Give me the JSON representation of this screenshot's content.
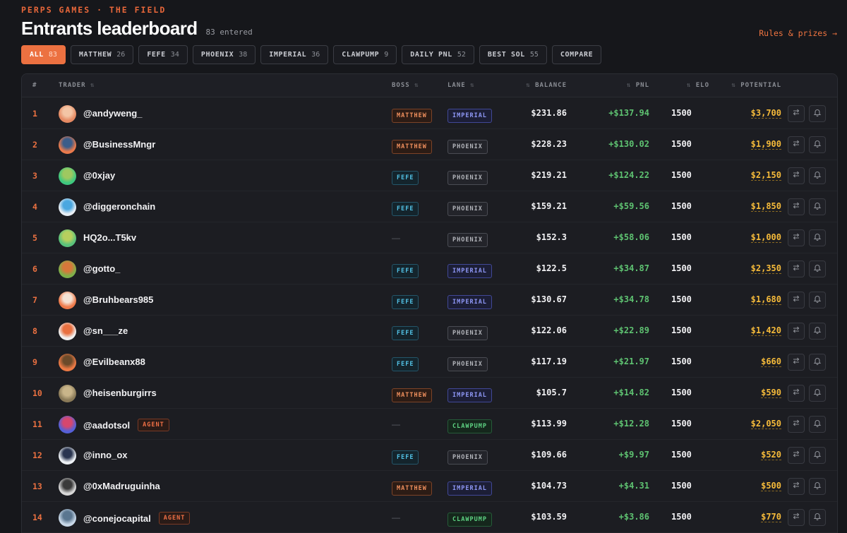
{
  "header": {
    "kicker": "PERPS GAMES · THE FIELD",
    "title": "Entrants leaderboard",
    "entered": "83 entered",
    "rules_link": "Rules & prizes →"
  },
  "tabs": [
    {
      "label": "ALL",
      "count": "83",
      "active": true
    },
    {
      "label": "MATTHEW",
      "count": "26"
    },
    {
      "label": "FEFE",
      "count": "34"
    },
    {
      "label": "PHOENIX",
      "count": "38"
    },
    {
      "label": "IMPERIAL",
      "count": "36"
    },
    {
      "label": "CLAWPUMP",
      "count": "9"
    },
    {
      "label": "DAILY PNL",
      "count": "52"
    },
    {
      "label": "BEST SOL",
      "count": "55"
    },
    {
      "label": "COMPARE",
      "count": ""
    }
  ],
  "columns": {
    "rank": "#",
    "trader": "TRADER",
    "boss": "BOSS",
    "lane": "LANE",
    "balance": "BALANCE",
    "pnl": "PNL",
    "elo": "ELO",
    "potential": "POTENTIAL",
    "sort_glyph": "⇅"
  },
  "colors": {
    "accent": "#ec7141",
    "positive": "#5ec271",
    "potential": "#f6bb3a"
  },
  "rows": [
    {
      "rank": "1",
      "handle": "@andyweng_",
      "boss": "MATTHEW",
      "lane": "IMPERIAL",
      "balance": "$231.86",
      "pnl": "+$137.94",
      "elo": "1500",
      "potential": "$3,700",
      "avatar": [
        "#e58a63",
        "#f3c5a5"
      ]
    },
    {
      "rank": "2",
      "handle": "@BusinessMngr",
      "boss": "MATTHEW",
      "lane": "PHOENIX",
      "balance": "$228.23",
      "pnl": "+$130.02",
      "elo": "1500",
      "potential": "$1,900",
      "avatar": [
        "#ea7a4c",
        "#3b5d8a"
      ]
    },
    {
      "rank": "3",
      "handle": "@0xjay",
      "boss": "FEFE",
      "lane": "PHOENIX",
      "balance": "$219.21",
      "pnl": "+$124.22",
      "elo": "1500",
      "potential": "$2,150",
      "avatar": [
        "#3ec87f",
        "#9ec860"
      ]
    },
    {
      "rank": "4",
      "handle": "@diggeronchain",
      "boss": "FEFE",
      "lane": "PHOENIX",
      "balance": "$159.21",
      "pnl": "+$59.56",
      "elo": "1500",
      "potential": "$1,850",
      "avatar": [
        "#e8eef4",
        "#4aa7e0"
      ]
    },
    {
      "rank": "5",
      "handle": "HQ2o...T5kv",
      "boss": "",
      "lane": "PHOENIX",
      "balance": "$152.3",
      "pnl": "+$58.06",
      "elo": "1500",
      "potential": "$1,000",
      "avatar": [
        "#59c27b",
        "#b7cf5e"
      ]
    },
    {
      "rank": "6",
      "handle": "@gotto_",
      "boss": "FEFE",
      "lane": "IMPERIAL",
      "balance": "$122.5",
      "pnl": "+$34.87",
      "elo": "1500",
      "potential": "$2,350",
      "avatar": [
        "#7fb04a",
        "#d8773a"
      ]
    },
    {
      "rank": "7",
      "handle": "@Bruhbears985",
      "boss": "FEFE",
      "lane": "IMPERIAL",
      "balance": "$130.67",
      "pnl": "+$34.78",
      "elo": "1500",
      "potential": "$1,680",
      "avatar": [
        "#ee7a4a",
        "#f4e2d4"
      ]
    },
    {
      "rank": "8",
      "handle": "@sn___ze",
      "boss": "FEFE",
      "lane": "PHOENIX",
      "balance": "$122.06",
      "pnl": "+$22.89",
      "elo": "1500",
      "potential": "$1,420",
      "avatar": [
        "#f0f0f0",
        "#e97040"
      ]
    },
    {
      "rank": "9",
      "handle": "@Evilbeanx88",
      "boss": "FEFE",
      "lane": "PHOENIX",
      "balance": "$117.19",
      "pnl": "+$21.97",
      "elo": "1500",
      "potential": "$660",
      "avatar": [
        "#ec7a45",
        "#6b4a2a"
      ]
    },
    {
      "rank": "10",
      "handle": "@heisenburgirrs",
      "boss": "MATTHEW",
      "lane": "IMPERIAL",
      "balance": "$105.7",
      "pnl": "+$14.82",
      "elo": "1500",
      "potential": "$590",
      "avatar": [
        "#8a7a58",
        "#c9b58a"
      ]
    },
    {
      "rank": "11",
      "handle": "@aadotsol",
      "agent": "AGENT",
      "boss": "",
      "lane": "CLAWPUMP",
      "balance": "$113.99",
      "pnl": "+$12.28",
      "elo": "1500",
      "potential": "$2,050",
      "avatar": [
        "#5560d8",
        "#d6476e"
      ]
    },
    {
      "rank": "12",
      "handle": "@inno_ox",
      "boss": "FEFE",
      "lane": "PHOENIX",
      "balance": "$109.66",
      "pnl": "+$9.97",
      "elo": "1500",
      "potential": "$520",
      "avatar": [
        "#eef2f6",
        "#2a3550"
      ]
    },
    {
      "rank": "13",
      "handle": "@0xMadruguinha",
      "boss": "MATTHEW",
      "lane": "IMPERIAL",
      "balance": "$104.73",
      "pnl": "+$4.31",
      "elo": "1500",
      "potential": "$500",
      "avatar": [
        "#d8d8d8",
        "#3a3a3a"
      ]
    },
    {
      "rank": "14",
      "handle": "@conejocapital",
      "agent": "AGENT",
      "boss": "",
      "lane": "CLAWPUMP",
      "balance": "$103.59",
      "pnl": "+$3.86",
      "elo": "1500",
      "potential": "$770",
      "avatar": [
        "#c8d8e8",
        "#5a7690"
      ]
    }
  ],
  "empty_boss": "—",
  "icons": {
    "swap": "swap-icon",
    "bell": "bell-icon"
  }
}
